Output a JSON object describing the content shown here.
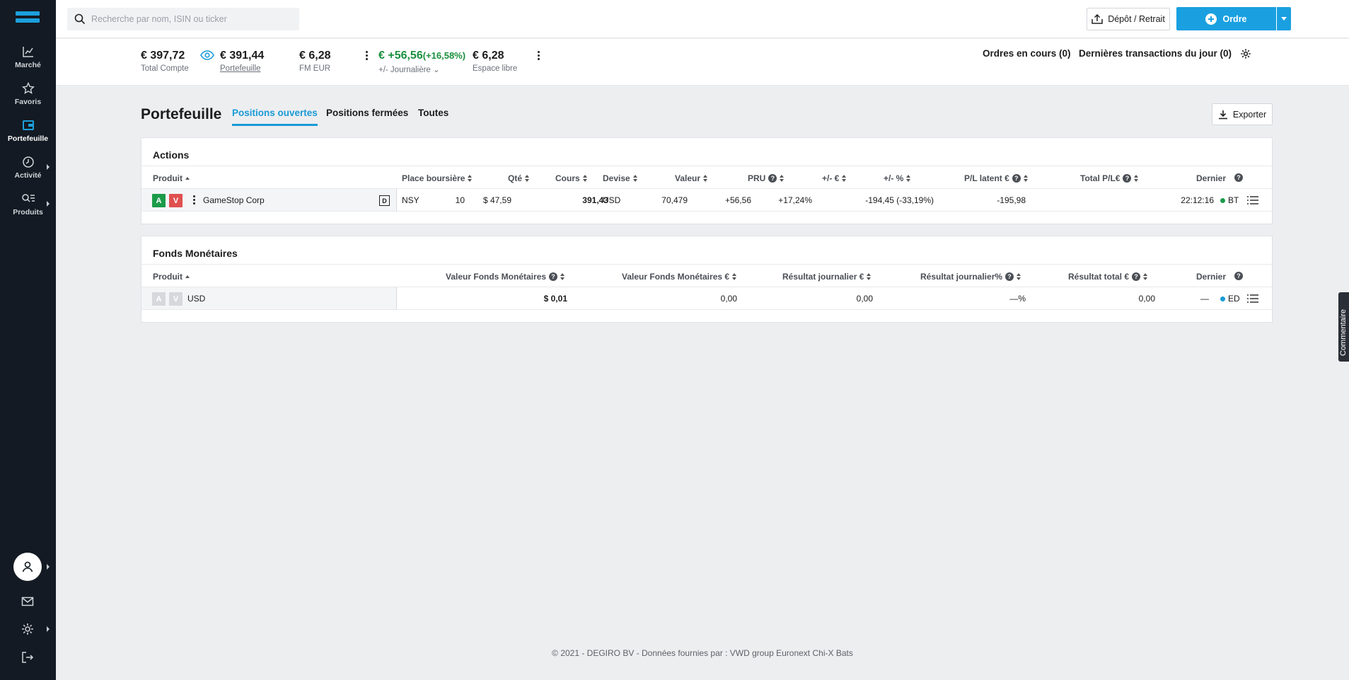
{
  "sidebar": {
    "items": [
      {
        "label": "Marché",
        "icon": "chart-line-icon"
      },
      {
        "label": "Favoris",
        "icon": "star-icon"
      },
      {
        "label": "Portefeuille",
        "icon": "wallet-icon"
      },
      {
        "label": "Activité",
        "icon": "clock-icon"
      },
      {
        "label": "Produits",
        "icon": "search-list-icon"
      }
    ]
  },
  "topbar": {
    "search_placeholder": "Recherche par nom, ISIN ou ticker",
    "depot_label": "Dépôt / Retrait",
    "ordre_label": "Ordre"
  },
  "summary": {
    "total_value": "€ 397,72",
    "total_label": "Total Compte",
    "portefeuille_value": "€ 391,44",
    "portefeuille_label": "Portefeuille",
    "fm_value": "€ 6,28",
    "fm_label": "FM EUR",
    "daily_value": "€ +56,56",
    "daily_pct": "(+16,58%)",
    "daily_label": "+/- Journalière",
    "free_value": "€ 6,28",
    "free_label": "Espace libre",
    "orders_link": "Ordres en cours (0)",
    "transactions_link": "Dernières transactions du jour (0)"
  },
  "page": {
    "title": "Portefeuille",
    "tabs": [
      "Positions ouvertes",
      "Positions fermées",
      "Toutes"
    ],
    "export_label": "Exporter"
  },
  "actions": {
    "title": "Actions",
    "headers": {
      "produit": "Produit",
      "place": "Place boursière",
      "qte": "Qté",
      "cours": "Cours",
      "devise": "Devise",
      "valeur": "Valeur",
      "pru": "PRU",
      "pm_eur": "+/- €",
      "pm_pct": "+/- %",
      "pl_latent": "P/L latent €",
      "total_pl": "Total P/L€",
      "dernier": "Dernier"
    },
    "row": {
      "buy": "A",
      "sell": "V",
      "produit": "GameStop Corp",
      "badge": "D",
      "place": "NSY",
      "qte": "10",
      "cours": "$ 47,59",
      "devise": "USD",
      "valeur": "391,43",
      "pru": "70,479",
      "pm_eur": "+56,56",
      "pm_pct": "+17,24%",
      "pl_latent": "-194,45 (-33,19%)",
      "total_pl": "-195,98",
      "dernier": "22:12:16",
      "exchange": "BT"
    }
  },
  "fonds": {
    "title": "Fonds Monétaires",
    "headers": {
      "produit": "Produit",
      "valeur_fm": "Valeur Fonds Monétaires",
      "valeur_fm_eur": "Valeur Fonds Monétaires €",
      "res_journalier": "Résultat journalier €",
      "res_journalier_pct": "Résultat journalier%",
      "res_total": "Résultat total €",
      "dernier": "Dernier"
    },
    "row": {
      "buy": "A",
      "sell": "V",
      "produit": "USD",
      "valeur_fm": "$ 0,01",
      "valeur_fm_eur": "0,00",
      "res_journalier": "0,00",
      "res_journalier_pct": "—%",
      "res_total": "0,00",
      "dernier": "—",
      "exchange": "ED"
    }
  },
  "footer": "© 2021 - DEGIRO BV - Données fournies par : VWD group Euronext Chi-X Bats",
  "side_tab": "Commentaire",
  "colors": {
    "accent": "#1aa0e0",
    "positive": "#1a8f3e",
    "negative": "#d9413b",
    "sidebar": "#141a23"
  }
}
